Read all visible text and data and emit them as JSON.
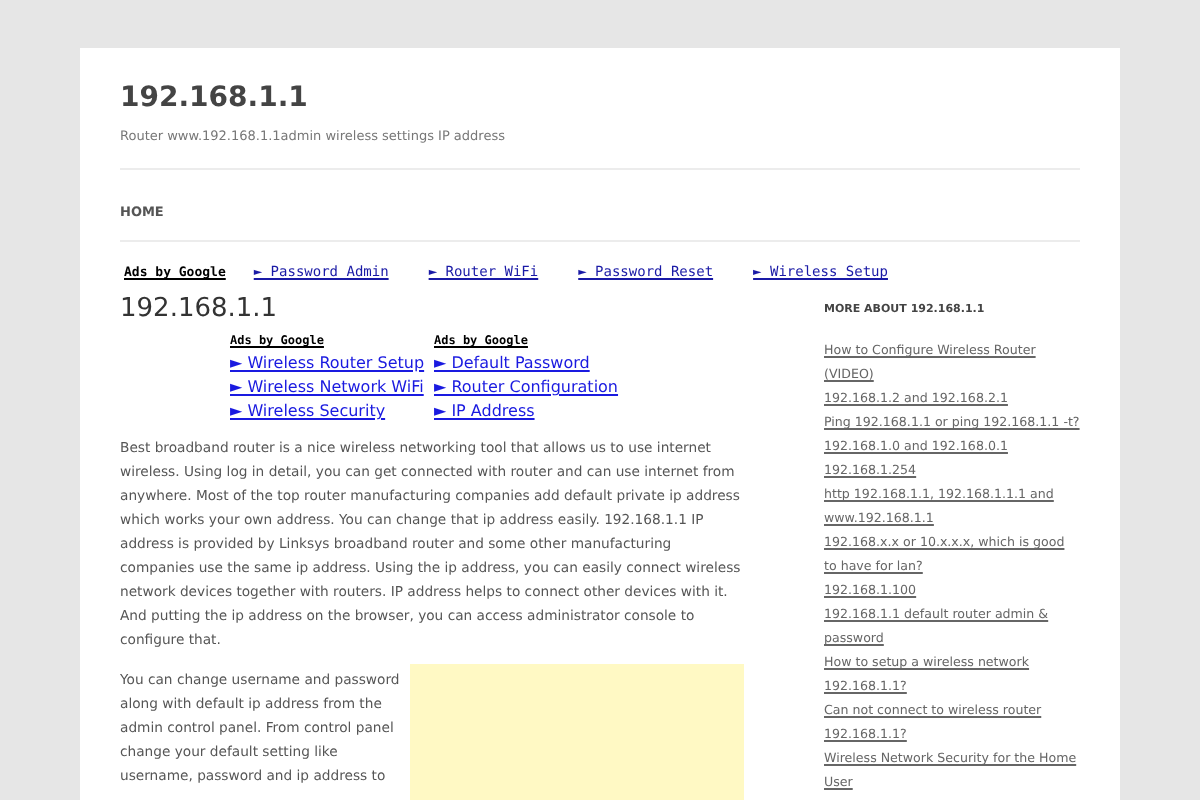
{
  "site": {
    "title": "192.168.1.1",
    "tagline": "Router www.192.168.1.1admin wireless settings IP address"
  },
  "nav": [
    {
      "label": "HOME"
    }
  ],
  "ad_bar": {
    "label": "Ads by Google",
    "links": [
      "► Password Admin",
      "► Router WiFi",
      "► Password Reset",
      "► Wireless Setup"
    ]
  },
  "article": {
    "title": "192.168.1.1",
    "ad_units": [
      {
        "label": "Ads by Google",
        "links": [
          "► Wireless Router Setup",
          "► Wireless Network WiFi",
          "► Wireless Security"
        ]
      },
      {
        "label": "Ads by Google",
        "links": [
          "► Default Password",
          "► Router Configuration",
          "► IP Address"
        ]
      }
    ],
    "paragraphs": [
      "Best broadband router is a nice wireless networking tool that allows us to use internet wireless. Using log in detail, you can get connected with router and can use internet from anywhere. Most of the top router manufacturing companies add default private ip address which works your own address. You can change that ip address easily. 192.168.1.1 IP address is provided by Linksys broadband router and some other manufacturing companies use the same ip address. Using the ip address, you can easily connect wireless network devices together with routers. IP address helps to connect other devices with it. And putting the ip address on the browser, you can access administrator console to configure that.",
      "You can change username and password along with default ip address from the admin control panel. From control panel change your default setting like username, password and ip address to"
    ]
  },
  "sidebar": {
    "heading": "MORE ABOUT 192.168.1.1",
    "links": [
      "How to Configure Wireless Router (VIDEO)",
      "192.168.1.2 and 192.168.2.1",
      "Ping 192.168.1.1 or ping 192.168.1.1 -t?",
      "192.168.1.0 and 192.168.0.1",
      "192.168.1.254",
      "http 192.168.1.1, 192.168.1.1.1 and www.192.168.1.1",
      "192.168.x.x or 10.x.x.x, which is good to have for lan?",
      "192.168.1.100",
      "192.168.1.1 default router admin & password",
      "How to setup a wireless network 192.168.1.1?",
      "Can not connect to wireless router 192.168.1.1?",
      "Wireless Network Security for the Home User"
    ]
  }
}
